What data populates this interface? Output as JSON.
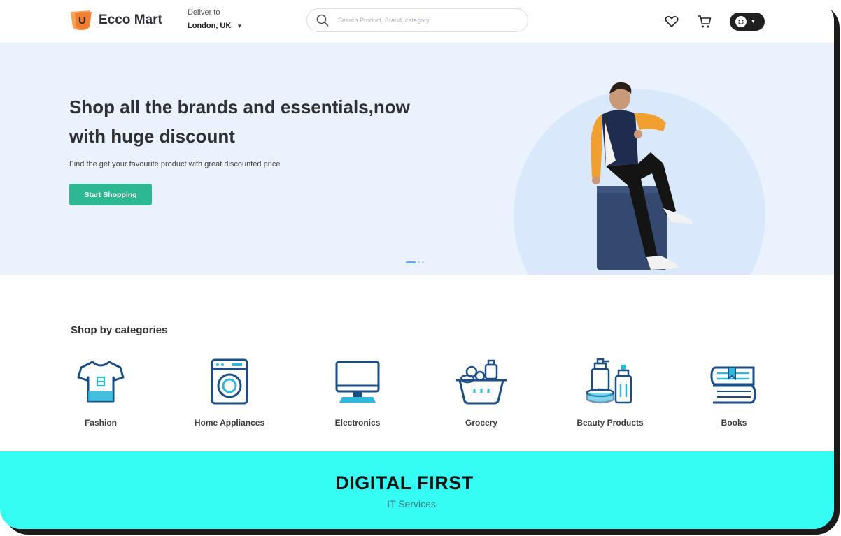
{
  "brand": {
    "name": "Ecco Mart",
    "logo_letter": "U",
    "accent": "#f07b2d"
  },
  "deliver": {
    "label": "Deliver to",
    "location": "London, UK"
  },
  "search": {
    "placeholder": "Search Product, Brand, category"
  },
  "header_icons": [
    "heart-icon",
    "cart-icon",
    "user-avatar-icon"
  ],
  "hero": {
    "title": "Shop all the brands and essentials,now with huge discount",
    "subtitle": "Find the get your favourite product with great discounted price",
    "cta": "Start Shopping",
    "cta_color": "#2db892",
    "background": "#eaf2fe",
    "slides": 3,
    "active_slide": 1
  },
  "categories": {
    "title": "Shop by categories",
    "items": [
      {
        "label": "Fashion",
        "icon": "tshirt-icon"
      },
      {
        "label": "Home Appliances",
        "icon": "washing-machine-icon"
      },
      {
        "label": "Electronics",
        "icon": "monitor-icon"
      },
      {
        "label": "Grocery",
        "icon": "basket-icon"
      },
      {
        "label": "Beauty Products",
        "icon": "cosmetics-icon"
      },
      {
        "label": "Books",
        "icon": "books-icon"
      }
    ]
  },
  "band": {
    "title": "DIGITAL FIRST",
    "subtitle": "IT Services",
    "color": "#35fdf4"
  }
}
